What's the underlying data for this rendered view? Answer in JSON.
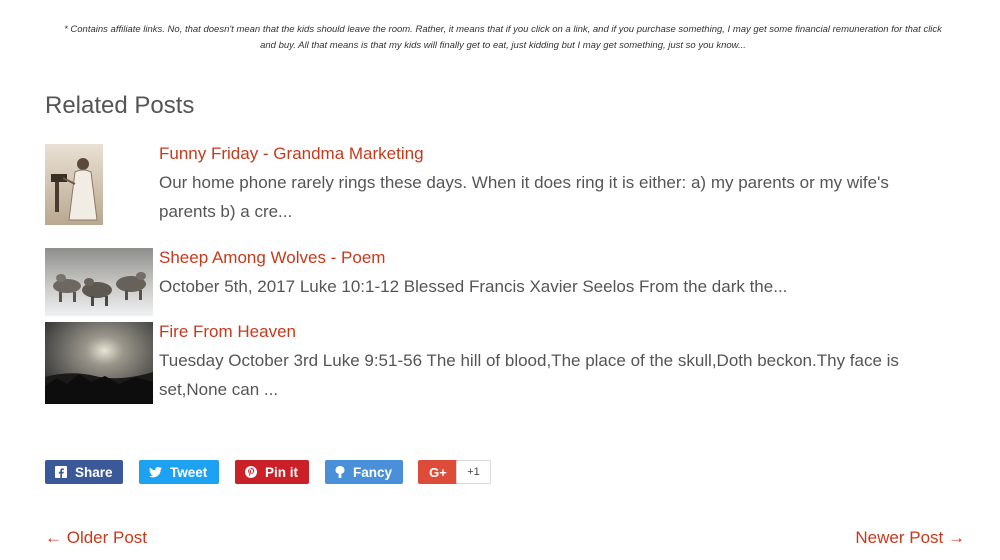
{
  "disclaimer": {
    "line1": "* Contains affiliate links.  No, that doesn't mean that the kids should leave the room.  Rather, it means that if you click on a link, and if you purchase something, I may get some financial remuneration for that click",
    "line2": "and buy.  All that means is that my kids will finally get to eat, just kidding but I may get something, just so you know..."
  },
  "related": {
    "heading": "Related Posts",
    "posts": [
      {
        "title": "Funny Friday - Grandma Marketing",
        "excerpt": "Our home phone rarely rings these days. When it does ring it is either: a) my parents or my wife's parents b) a cre..."
      },
      {
        "title": "Sheep Among Wolves - Poem",
        "excerpt": "October 5th, 2017 Luke 10:1-12 Blessed Francis Xavier Seelos From the dark the..."
      },
      {
        "title": "Fire From Heaven",
        "excerpt": "Tuesday October 3rd Luke 9:51-56 The hill of blood,The place of the skull,Doth beckon.Thy face is set,None can ..."
      }
    ]
  },
  "share": {
    "facebook": {
      "label": "Share",
      "icon": "facebook-icon",
      "color": "#3b5998"
    },
    "twitter": {
      "label": "Tweet",
      "icon": "twitter-icon",
      "color": "#1da1f2"
    },
    "pinterest": {
      "label": "Pin it",
      "icon": "pinterest-icon",
      "color": "#cb2027"
    },
    "fancy": {
      "label": "Fancy",
      "icon": "fancy-icon",
      "color": "#4a90d9"
    },
    "gplus": {
      "label": "G+",
      "icon": "google-plus-icon",
      "color": "#dd4b39",
      "count": "+1"
    }
  },
  "navigation": {
    "older": "← Older Post",
    "newer": "Newer Post →"
  },
  "colors": {
    "link": "#c8391c",
    "text": "#555555"
  }
}
